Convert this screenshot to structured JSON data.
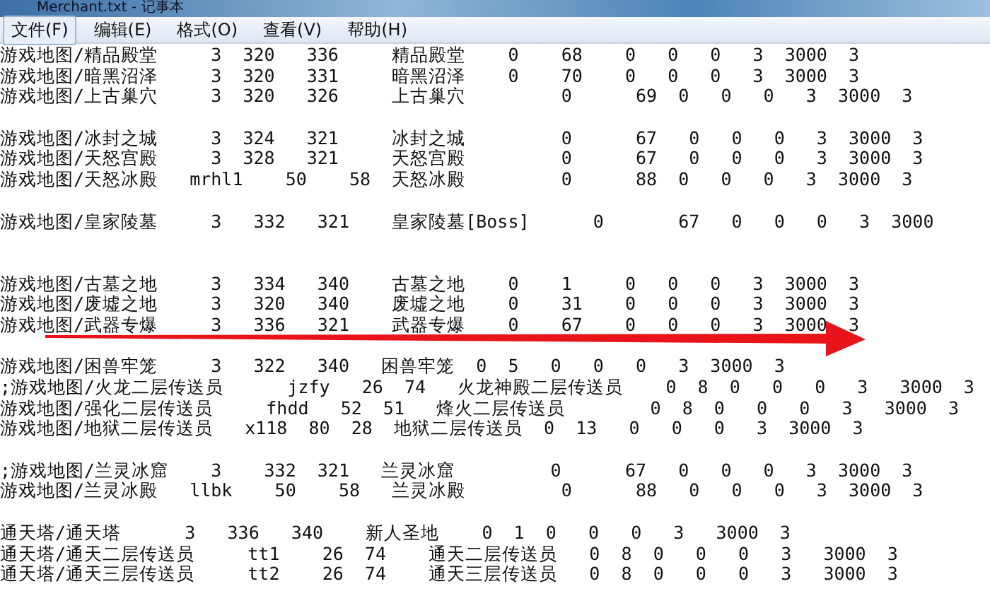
{
  "window": {
    "title": "Merchant.txt - 记事本"
  },
  "menu": [
    {
      "label": "文件(F)",
      "selected": true
    },
    {
      "label": "编辑(E)",
      "selected": false
    },
    {
      "label": "格式(O)",
      "selected": false
    },
    {
      "label": "查看(V)",
      "selected": false
    },
    {
      "label": "帮助(H)",
      "selected": false
    }
  ],
  "lines": [
    {
      "kind": "text",
      "text": "游戏地图/精品殿堂     3  320   336     精品殿堂    0    68    0   0   0   3  3000  3"
    },
    {
      "kind": "text",
      "text": "游戏地图/暗黑沼泽     3  320   331     暗黑沼泽    0    70    0   0   0   3  3000  3"
    },
    {
      "kind": "text",
      "text": "游戏地图/上古巢穴     3  320   326     上古巢穴         0      69  0   0   0   3  3000  3"
    },
    {
      "kind": "blank"
    },
    {
      "kind": "text",
      "text": "游戏地图/冰封之城     3  324   321     冰封之城         0      67   0   0   0   3  3000  3"
    },
    {
      "kind": "text",
      "text": "游戏地图/天怒宫殿     3  328   321     天怒宫殿         0      67   0   0   0   3  3000  3"
    },
    {
      "kind": "text",
      "text": "游戏地图/天怒冰殿   mrhl1    50    58  天怒冰殿         0      88  0   0   0   3  3000  3"
    },
    {
      "kind": "blank"
    },
    {
      "kind": "text",
      "text": "游戏地图/皇家陵墓     3   332   321    皇家陵墓[Boss]      0       67   0   0   0   3  3000"
    },
    {
      "kind": "blank"
    },
    {
      "kind": "blank"
    },
    {
      "kind": "text",
      "text": "游戏地图/古墓之地     3   334   340    古墓之地    0    1     0   0   0   3  3000  3"
    },
    {
      "kind": "text",
      "text": "游戏地图/废墟之地     3   320   340    废墟之地    0    31    0   0   0   3  3000  3"
    },
    {
      "kind": "text",
      "text": "游戏地图/武器专爆     3   336   321    武器专爆    0    67    0   0   0   3  3000  3"
    },
    {
      "kind": "blank"
    },
    {
      "kind": "text",
      "text": "游戏地图/困兽牢笼     3   322   340   困兽牢笼  0  5   0   0   0   3  3000  3"
    },
    {
      "kind": "text",
      "text": ";游戏地图/火龙二层传送员      jzfy   26  74   火龙神殿二层传送员    0  8  0   0   0   3   3000  3"
    },
    {
      "kind": "text",
      "text": "游戏地图/强化二层传送员     fhdd   52  51   烽火二层传送员        0  8  0   0   0   3   3000  3"
    },
    {
      "kind": "text",
      "text": "游戏地图/地狱二层传送员   x118  80  28  地狱二层传送员  0  13   0   0   0   3  3000  3"
    },
    {
      "kind": "blank"
    },
    {
      "kind": "text",
      "text": ";游戏地图/兰灵冰窟    3    332  321   兰灵冰窟         0      67   0   0   0   3  3000  3"
    },
    {
      "kind": "text",
      "text": "游戏地图/兰灵冰殿   llbk    50    58   兰灵冰殿         0      88   0   0   0   3  3000  3"
    },
    {
      "kind": "blank"
    },
    {
      "kind": "text",
      "text": "通天塔/通天塔      3   336   340    新人圣地    0  1  0   0   0   3   3000  3"
    },
    {
      "kind": "text",
      "text": "通天塔/通天二层传送员     tt1    26  74    通天二层传送员   0  8  0   0   0   3   3000  3"
    },
    {
      "kind": "text",
      "text": "通天塔/通天三层传送员     tt2    26  74    通天三层传送员   0  8  0   0   0   3   3000  3"
    }
  ]
}
